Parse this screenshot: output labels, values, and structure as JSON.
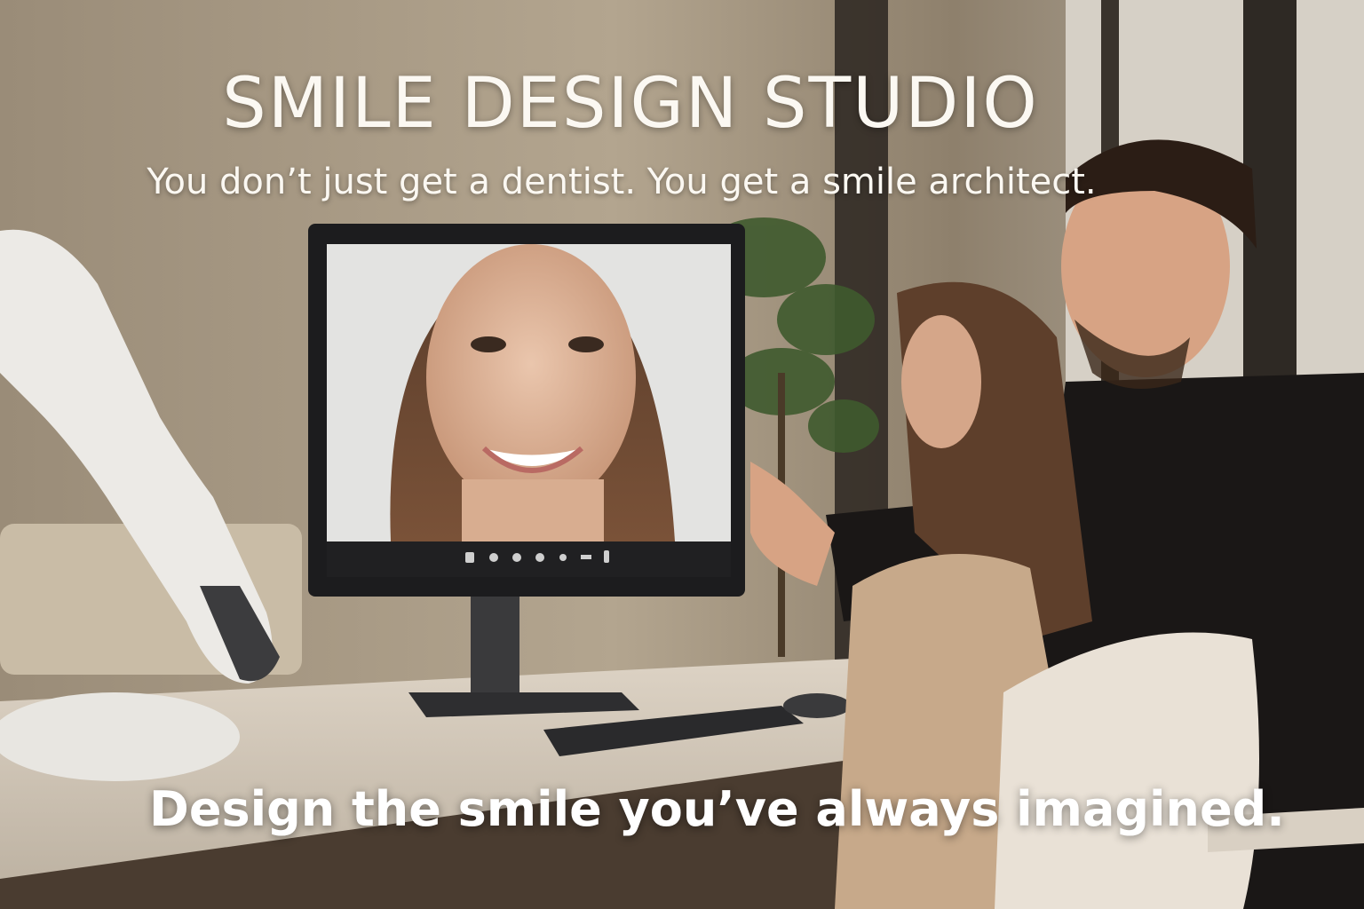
{
  "hero": {
    "title": "SMILE DESIGN STUDIO",
    "subtitle": "You don’t just get a dentist. You get a smile architect.",
    "cta_text": "Design the smile you’ve always imagined."
  },
  "monitor": {
    "toolbar_icons": [
      "tooth-icon",
      "grid-icon",
      "smile-icon",
      "layers-icon",
      "record-icon",
      "ruler-icon",
      "phone-icon"
    ]
  },
  "colors": {
    "text": "#fbf8f2",
    "wall": "#a99a85",
    "blazer": "#c7a98a",
    "jacket": "#1a1716"
  }
}
